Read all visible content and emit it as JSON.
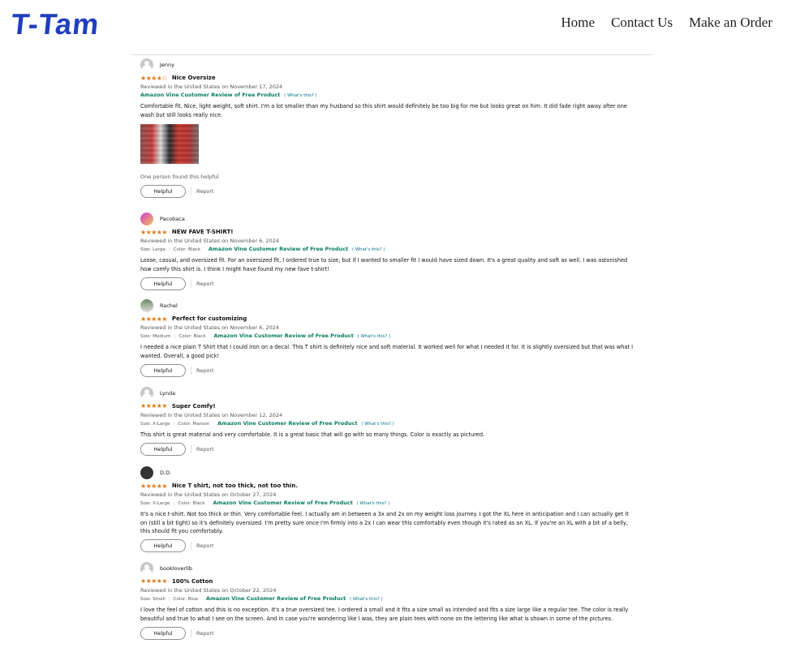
{
  "header": {
    "logo": "T-Tam",
    "nav": [
      "Home",
      "Contact Us",
      "Make an Order"
    ]
  },
  "reviews": [
    {
      "name": "Jenny",
      "stars": 4,
      "title": "Nice Oversize",
      "date": "Reviewed in the United States on November 17, 2024",
      "size": "",
      "color": "",
      "vine": "Amazon Vine Customer Review of Free Product",
      "whats": "( What's this? )",
      "body": "Comfortable fit. Nice, light weight, soft shirt. I'm a lot smaller than my husband so this shirt would definitely be too big for me but looks great on him. It did fade right away after one wash but still looks really nice.",
      "helpful_count": "One person found this helpful",
      "helpful": "Helpful",
      "report": "Report"
    },
    {
      "name": "Pacobaca",
      "stars": 5,
      "title": "NEW FAVE T-SHIRT!",
      "date": "Reviewed in the United States on November 6, 2024",
      "size": "Size: Large",
      "color": "Color: Black",
      "vine": "Amazon Vine Customer Review of Free Product",
      "whats": "( What's this? )",
      "body": "Loose, casual, and oversized fit. For an oversized fit, I ordered true to size, but if I wanted to smaller fit I would have sized down. It's a great quality and soft as well. I was astonished how comfy this shirt is. I think I might have found my new fave t-shirt!",
      "helpful": "Helpful",
      "report": "Report"
    },
    {
      "name": "Rachel",
      "stars": 5,
      "title": "Perfect for customizing",
      "date": "Reviewed in the United States on November 6, 2024",
      "size": "Size: Medium",
      "color": "Color: Black",
      "vine": "Amazon Vine Customer Review of Free Product",
      "whats": "( What's this? )",
      "body": "I needed a nice plain T Shirt that I could iron on a decal. This T shirt is definitely nice and soft material. It worked well for what I needed it for. It is slightly oversized but that was what I wanted. Overall, a good pick!",
      "helpful": "Helpful",
      "report": "Report"
    },
    {
      "name": "Lynda",
      "stars": 5,
      "title": "Super Comfy!",
      "date": "Reviewed in the United States on November 12, 2024",
      "size": "Size: X-Large",
      "color": "Color: Maroon",
      "vine": "Amazon Vine Customer Review of Free Product",
      "whats": "( What's this? )",
      "body": "This shirt is great material and very comfortable. It is a great basic that will go with so many things. Color is exactly as pictured.",
      "helpful": "Helpful",
      "report": "Report"
    },
    {
      "name": "D.D.",
      "stars": 5,
      "title": "Nice T shirt, not too thick, not too thin.",
      "date": "Reviewed in the United States on October 27, 2024",
      "size": "Size: X-Large",
      "color": "Color: Black",
      "vine": "Amazon Vine Customer Review of Free Product",
      "whats": "( What's this? )",
      "body": "It's a nice t-shirt. Not too thick or thin. Very comfortable feel. I actually am in between a 3x and 2x on my weight loss journey. I got the XL here in anticipation and I can actually get it on (still a bit tight) so it's definitely oversized. I'm pretty sure once I'm firmly into a 2x I can wear this comfortably even though it's rated as an XL. If you're an XL with a bit of a belly, this should fit you comfortably.",
      "helpful": "Helpful",
      "report": "Report"
    },
    {
      "name": "bookloverlib",
      "stars": 5,
      "title": "100% Cotton",
      "date": "Reviewed in the United States on October 22, 2024",
      "size": "Size: Small",
      "color": "Color: Blue",
      "vine": "Amazon Vine Customer Review of Free Product",
      "whats": "( What's this? )",
      "body": "I love the feel of cotton and this is no exception. It's a true oversized tee. I ordered a small and it fits a size small as intended and fits a size large like a regular tee. The color is really beautiful and true to what I see on the screen. And in case you're wondering like I was, they are plain tees with none on the lettering like what is shown in some of the pictures.",
      "helpful": "Helpful",
      "report": "Report"
    }
  ],
  "colors": {
    "logo": "#1f3fbf",
    "star": "#e47911",
    "vine": "#067d62",
    "link": "#007185"
  }
}
